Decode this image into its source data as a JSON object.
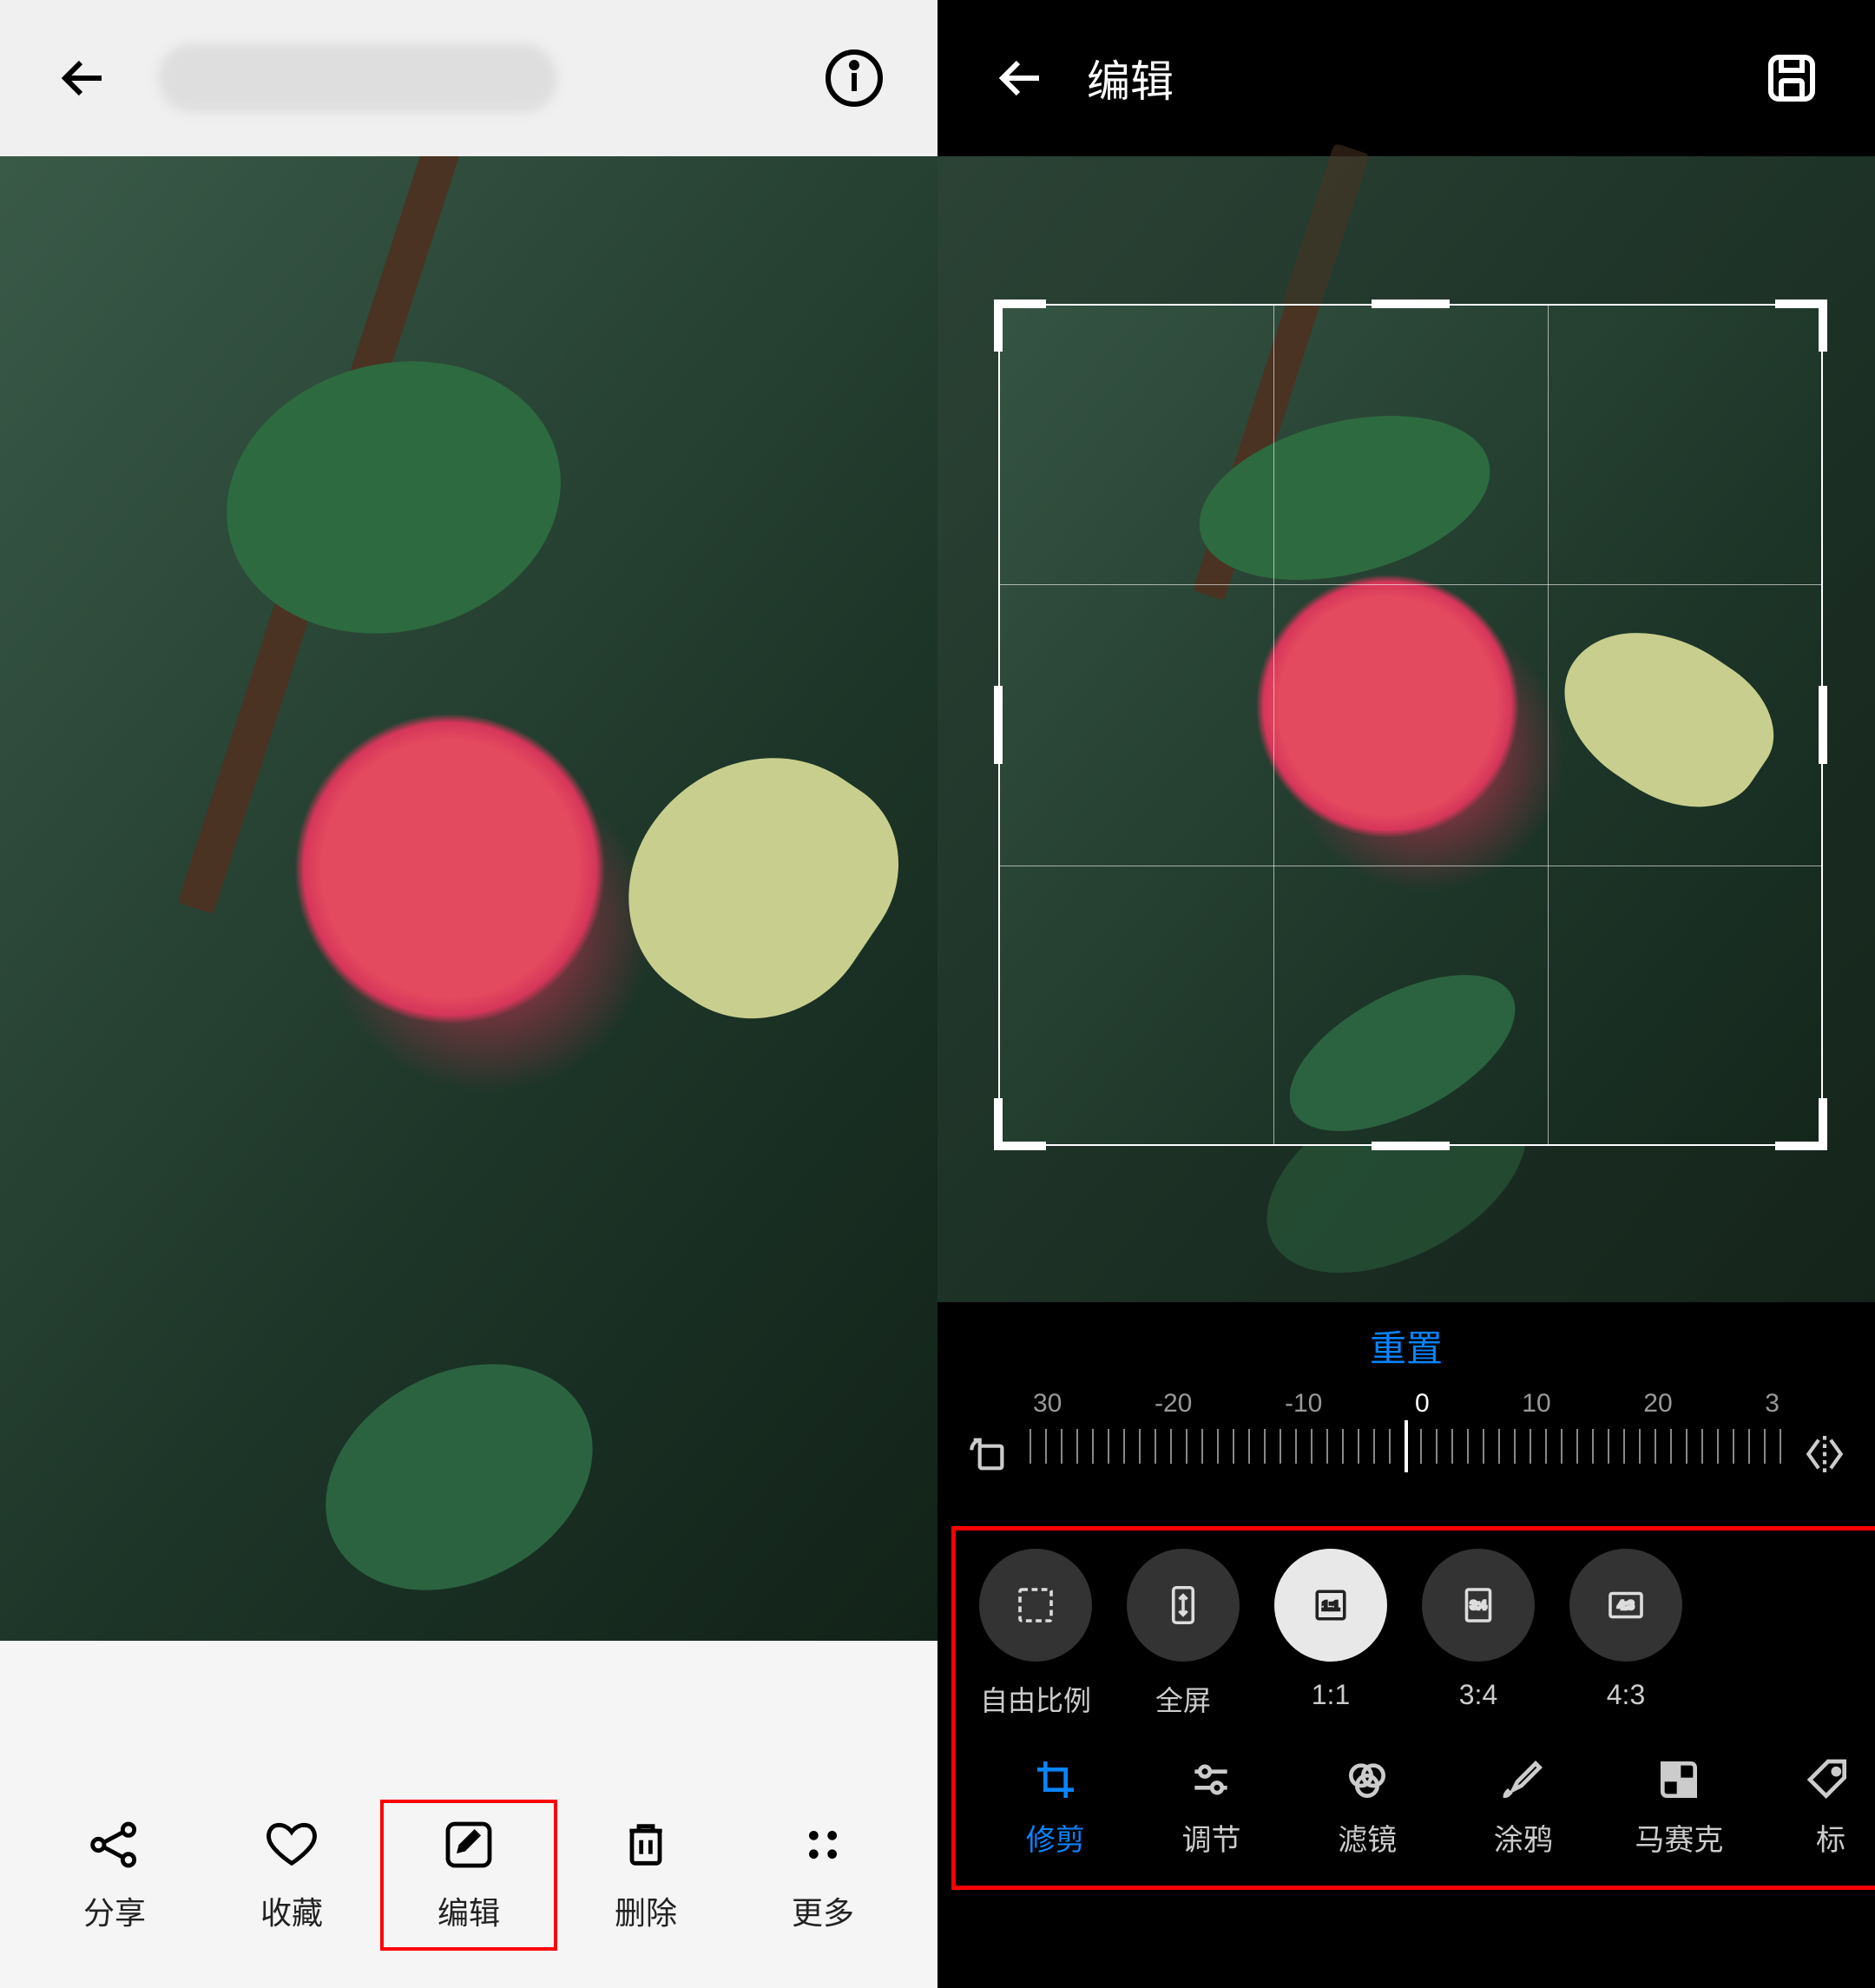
{
  "left": {
    "toolbar": {
      "share": "分享",
      "favorite": "收藏",
      "edit": "编辑",
      "delete": "删除",
      "more": "更多"
    }
  },
  "right": {
    "title": "编辑",
    "reset": "重置",
    "ruler_ticks": [
      "30",
      "-20",
      "-10",
      "0",
      "10",
      "20",
      "3"
    ],
    "ratios": [
      {
        "id": "free",
        "label": "自由比例"
      },
      {
        "id": "fullscreen",
        "label": "全屏"
      },
      {
        "id": "1-1",
        "label": "1:1",
        "active": true,
        "icon_text": "1:1"
      },
      {
        "id": "3-4",
        "label": "3:4",
        "icon_text": "3:4"
      },
      {
        "id": "4-3",
        "label": "4:3",
        "icon_text": "4:3"
      }
    ],
    "tabs": {
      "crop": "修剪",
      "adjust": "调节",
      "filter": "滤镜",
      "doodle": "涂鸦",
      "mosaic": "马赛克",
      "mark": "标"
    }
  },
  "colors": {
    "accent_blue": "#0a84ff",
    "highlight_red": "#ff0000"
  }
}
